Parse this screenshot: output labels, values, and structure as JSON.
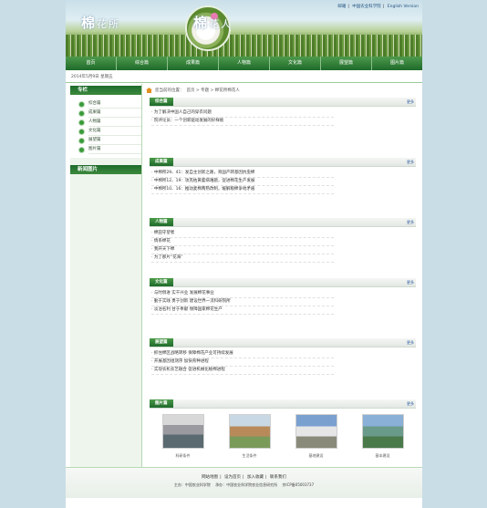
{
  "header": {
    "logo_left": {
      "big": "棉",
      "rest": "花所"
    },
    "logo_right": {
      "big": "棉",
      "rest": "花人"
    },
    "top_links": [
      "邮箱",
      "中国农业科学院",
      "English Version"
    ]
  },
  "nav": [
    "首页",
    "综合篇",
    "成果篇",
    "人物篇",
    "文化篇",
    "展望篇",
    "图片篇"
  ],
  "date": "2014年5月9日 星期五",
  "breadcrumb": {
    "prefix": "您当前的位置：",
    "path": "首页 > 专题 > 棉花所棉花人"
  },
  "sidebar": {
    "title": "专栏",
    "items": [
      "综合篇",
      "成果篇",
      "人物篇",
      "文化篇",
      "展望篇",
      "图片篇"
    ],
    "title2": "新闻图片"
  },
  "sections": [
    {
      "tag": "综合篇",
      "more": "更多",
      "rows": [
        "为了解决中国人自己的穿衣问题",
        "院评论员：一个创新驱动发展的好样板"
      ]
    },
    {
      "tag": "成果篇",
      "more": "更多",
      "rows": [
        "中棉所29、41：发自主创新之路，育国产转基因抗虫棉",
        "中棉所12、19：攻克枯黄萎病难题，促进棉花生产发展",
        "中棉所10、16：推动麦棉两熟改制，缓解粮棉争地矛盾"
      ]
    },
    {
      "tag": "人物篇",
      "more": "更多",
      "rows": [
        "棉田守望者",
        "情系棉花",
        "我开天下棉",
        "为了那片“花海”"
      ]
    },
    {
      "tag": "文化篇",
      "more": "更多",
      "rows": [
        "与时俱进 实干兴业 发展棉花事业",
        "勤于实践 勇于创新 建设世界一流科研院所",
        "淡泊名利 甘于奉献 保障国家棉花生产"
      ]
    },
    {
      "tag": "展望篇",
      "more": "更多",
      "rows": [
        "抓住棉区战略转移 保障棉花产业可持续发展",
        "开展基因组测序 加快育种进程",
        "实现农机农艺融合 促进机械化植棉进程"
      ]
    }
  ],
  "gallery": {
    "tag": "图片篇",
    "more": "更多",
    "items": [
      "科研条件",
      "生活条件",
      "基地建设",
      "基本建设"
    ]
  },
  "footer": {
    "links": [
      "网站地图",
      "设为首页",
      "加入收藏",
      "联系我们"
    ],
    "info": [
      "主办：中国农业科学院",
      "承办：中国农业科学院农业信息研究所",
      "京ICP备05003737"
    ]
  },
  "colors": {
    "nav_green": "#1e6a2a",
    "accent_green": "#3d8a3d",
    "bg": "#c9dde6"
  }
}
